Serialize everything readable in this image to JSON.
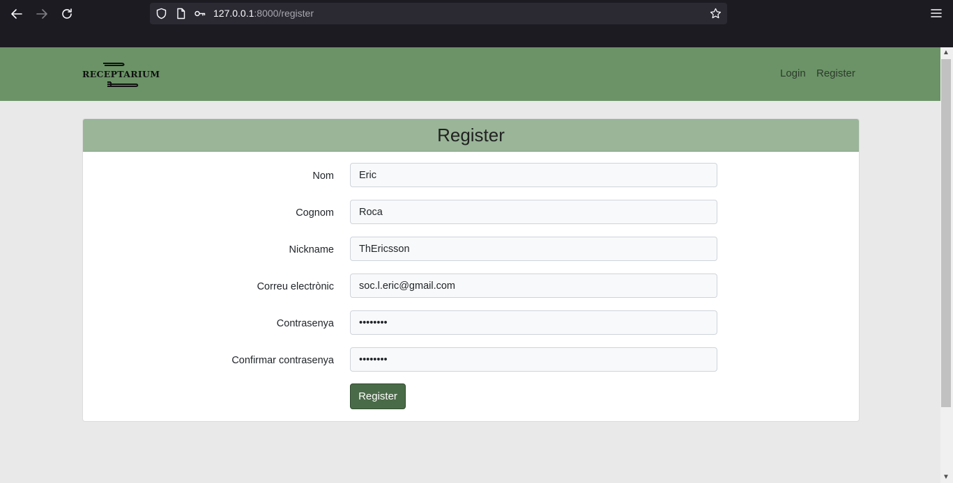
{
  "browser": {
    "url_host": "127.0.0.1",
    "url_rest": ":8000/register",
    "icons": [
      "back-arrow-icon",
      "forward-arrow-icon",
      "reload-icon",
      "shield-icon",
      "page-icon",
      "key-icon",
      "star-icon",
      "hamburger-menu-icon"
    ]
  },
  "navbar": {
    "logo_text": "RECEPTARIUM",
    "links": [
      {
        "label": "Login"
      },
      {
        "label": "Register"
      }
    ],
    "background": "#6b9367"
  },
  "form": {
    "title": "Register",
    "header_color": "#9ab598",
    "fields": [
      {
        "label": "Nom",
        "value": "Eric",
        "type": "text"
      },
      {
        "label": "Cognom",
        "value": "Roca",
        "type": "text"
      },
      {
        "label": "Nickname",
        "value": "ThEricsson",
        "type": "text"
      },
      {
        "label": "Correu electrònic",
        "value": "soc.l.eric@gmail.com",
        "type": "email"
      },
      {
        "label": "Contrasenya",
        "value": "password",
        "type": "password"
      },
      {
        "label": "Confirmar contrasenya",
        "value": "password",
        "type": "password"
      }
    ],
    "submit_label": "Register",
    "submit_color": "#4a6b47"
  }
}
